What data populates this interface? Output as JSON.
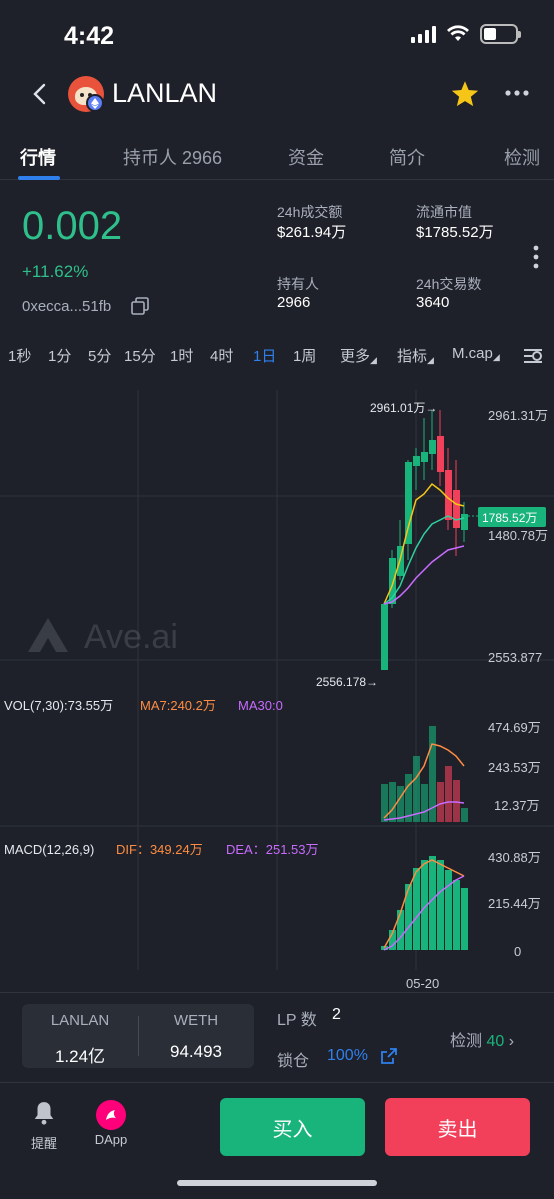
{
  "status": {
    "time": "4:42"
  },
  "header": {
    "title": "LANLAN"
  },
  "tabs": [
    {
      "label": "行情"
    },
    {
      "label": "持币人 2966"
    },
    {
      "label": "资金"
    },
    {
      "label": "简介"
    },
    {
      "label": "检测"
    }
  ],
  "token": {
    "price": "0.002",
    "change": "+11.62%",
    "address": "0xecca...51fb"
  },
  "stats": [
    {
      "label": "24h成交额",
      "value": "$261.94万"
    },
    {
      "label": "流通市值",
      "value": "$1785.52万"
    },
    {
      "label": "持有人",
      "value": "2966"
    },
    {
      "label": "24h交易数",
      "value": "3640"
    }
  ],
  "timeframes": [
    {
      "label": "1秒"
    },
    {
      "label": "1分"
    },
    {
      "label": "5分"
    },
    {
      "label": "15分"
    },
    {
      "label": "1时"
    },
    {
      "label": "4时"
    },
    {
      "label": "1日"
    },
    {
      "label": "1周"
    },
    {
      "label": "更多"
    },
    {
      "label": "指标"
    },
    {
      "label": "M.cap"
    }
  ],
  "chart": {
    "watermark": "Ave.ai",
    "max_label": "2961.01万→",
    "min_label": "2556.178→",
    "price_axis": [
      "2961.31万",
      "1480.78万",
      "2553.877"
    ],
    "current_tag": "1785.52万",
    "date_label": "05-20"
  },
  "volume": {
    "title": "VOL(7,30):73.55万",
    "ma7": "MA7:240.2万",
    "ma30": "MA30:0",
    "axis": [
      "474.69万",
      "243.53万",
      "12.37万"
    ]
  },
  "macd": {
    "title": "MACD(12,26,9)",
    "dif": "DIF：349.24万",
    "dea": "DEA：251.53万",
    "axis": [
      "430.88万",
      "215.44万",
      "0"
    ]
  },
  "pool": {
    "token_a": "LANLAN",
    "token_a_amount": "1.24亿",
    "token_b": "WETH",
    "token_b_amount": "94.493",
    "lp_label": "LP 数",
    "lp_value": "2",
    "lock_label": "锁仓",
    "lock_value": "100%",
    "detect_label": "检测",
    "detect_value": "40"
  },
  "nav": {
    "alert_label": "提醒",
    "dapp_label": "DApp",
    "buy_label": "买入",
    "sell_label": "卖出"
  },
  "colors": {
    "up": "#19b37c",
    "down": "#f2405a",
    "accent": "#2f80ed",
    "ma7": "#ff8c42",
    "ma30": "#c86bff",
    "yellow_ma": "#f5c518"
  }
}
